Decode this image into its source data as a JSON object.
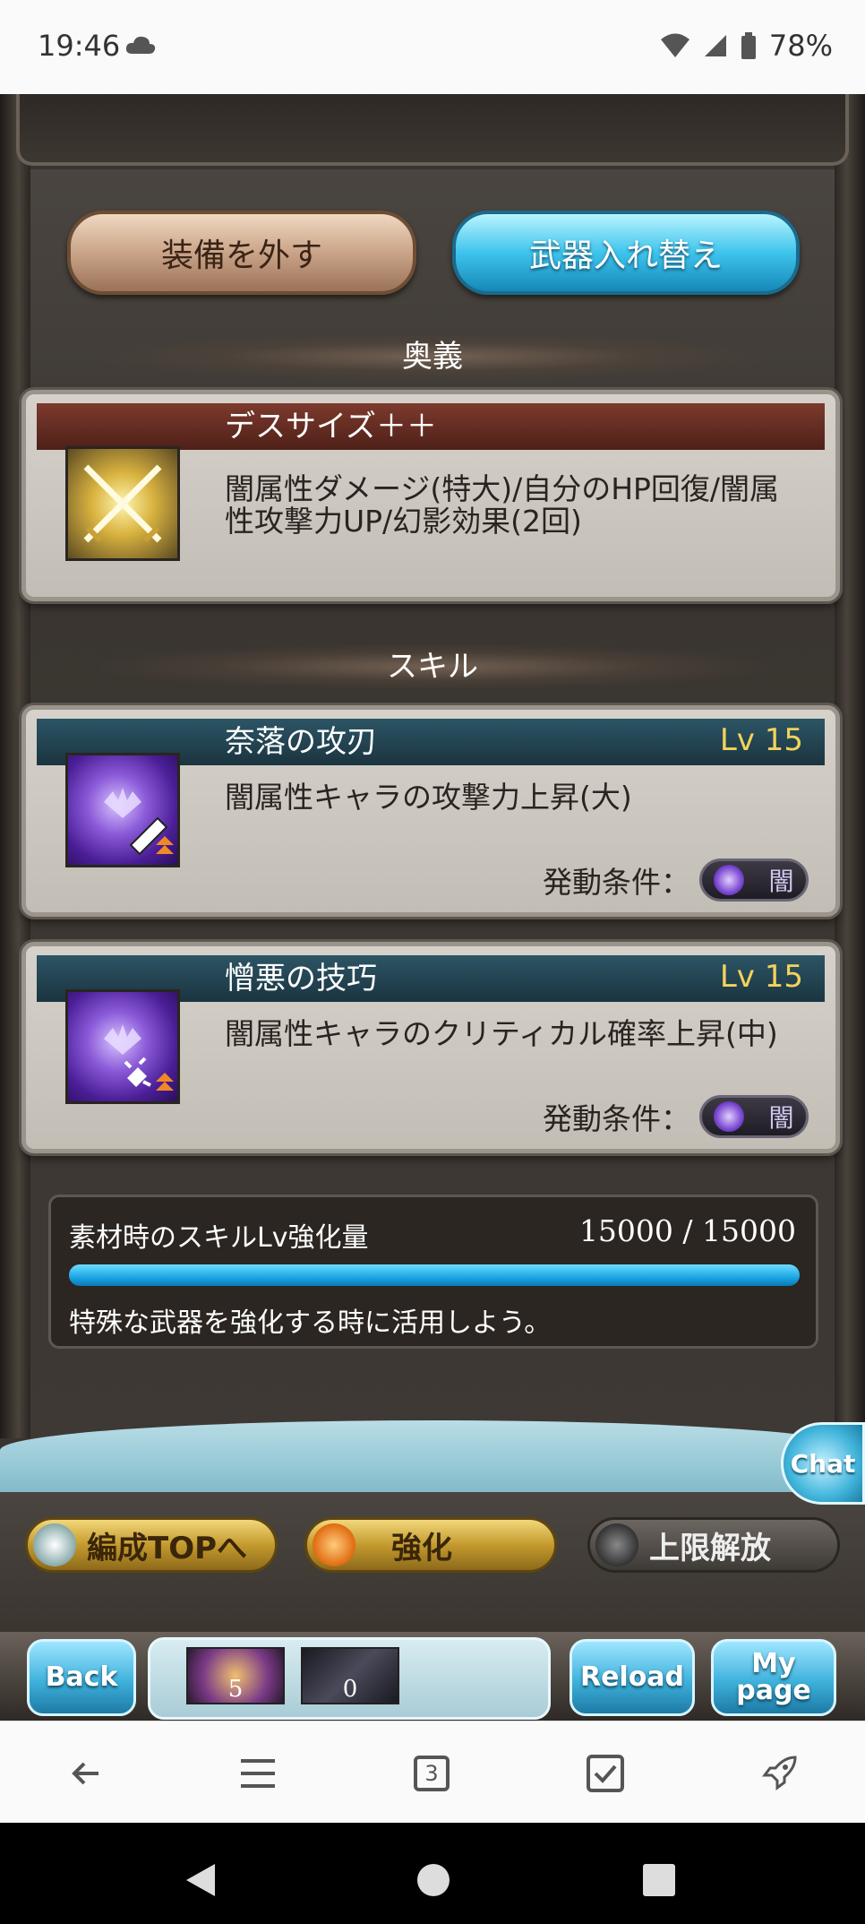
{
  "status_bar": {
    "time": "19:46",
    "battery": "78%"
  },
  "actions": {
    "unequip_label": "装備を外す",
    "swap_weapon_label": "武器入れ替え"
  },
  "ougi": {
    "section_title": "奥義",
    "name": "デスサイズ＋＋",
    "description": "闇属性ダメージ(特大)/自分のHP回復/闇属性攻撃力UP/幻影効果(2回)"
  },
  "skills": {
    "section_title": "スキル",
    "items": [
      {
        "name": "奈落の攻刃",
        "level": "Lv 15",
        "description": "闇属性キャラの攻撃力上昇(大)",
        "condition_label": "発動条件：",
        "condition_element": "闇"
      },
      {
        "name": "憎悪の技巧",
        "level": "Lv 15",
        "description": "闇属性キャラのクリティカル確率上昇(中)",
        "condition_label": "発動条件：",
        "condition_element": "闇"
      }
    ]
  },
  "material": {
    "label": "素材時のスキルLv強化量",
    "value": "15000 / 15000",
    "progress": 1.0,
    "hint": "特殊な武器を強化する時に活用しよう。"
  },
  "bottom_actions": {
    "party_top_label": "編成TOPへ",
    "upgrade_label": "強化",
    "uncap_label": "上限解放"
  },
  "chat_label": "Chat",
  "game_nav": {
    "back_label": "Back",
    "reload_label": "Reload",
    "mypage_label_line1": "My",
    "mypage_label_line2": "page",
    "item1_count": "5",
    "item2_count": "0"
  },
  "browser_nav": {
    "tab_count": "3"
  },
  "colors": {
    "skill_level": "#f3d35a",
    "progress_fill": "#1ca6e6",
    "ougi_header": "#6b2f24",
    "skill_header": "#23444f"
  }
}
